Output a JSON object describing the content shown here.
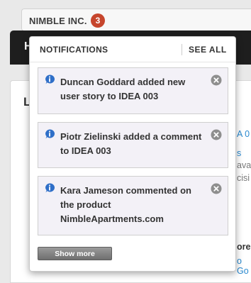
{
  "app": {
    "company_name": "NIMBLE INC.",
    "notification_count": "3",
    "darkbar_initial": "H",
    "panel_initial": "L"
  },
  "background_fragments": [
    {
      "text": "A 0",
      "style": "blue"
    },
    {
      "text": "s",
      "style": "blue"
    },
    {
      "text": "ava",
      "style": "gray"
    },
    {
      "text": "cisi",
      "style": "gray"
    },
    {
      "text": "ore",
      "style": "dark"
    },
    {
      "text": "o Go",
      "style": "blue"
    }
  ],
  "notifications": {
    "title": "NOTIFICATIONS",
    "see_all_label": "SEE ALL",
    "items": [
      {
        "text": "Duncan Goddard added new user story to IDEA 003",
        "icon": "info-icon"
      },
      {
        "text": "Piotr Zielinski added a comment to IDEA 003",
        "icon": "info-icon"
      },
      {
        "text": "Kara Jameson commented on the product NimbleApartments.com",
        "icon": "info-icon"
      }
    ],
    "show_more_label": "Show more"
  },
  "colors": {
    "badge": "#c6452c",
    "dark_bar": "#1e1e1e",
    "notification_bg": "#f3f1f7",
    "info_icon": "#2f6fc8",
    "link_blue": "#2a8ad0"
  }
}
